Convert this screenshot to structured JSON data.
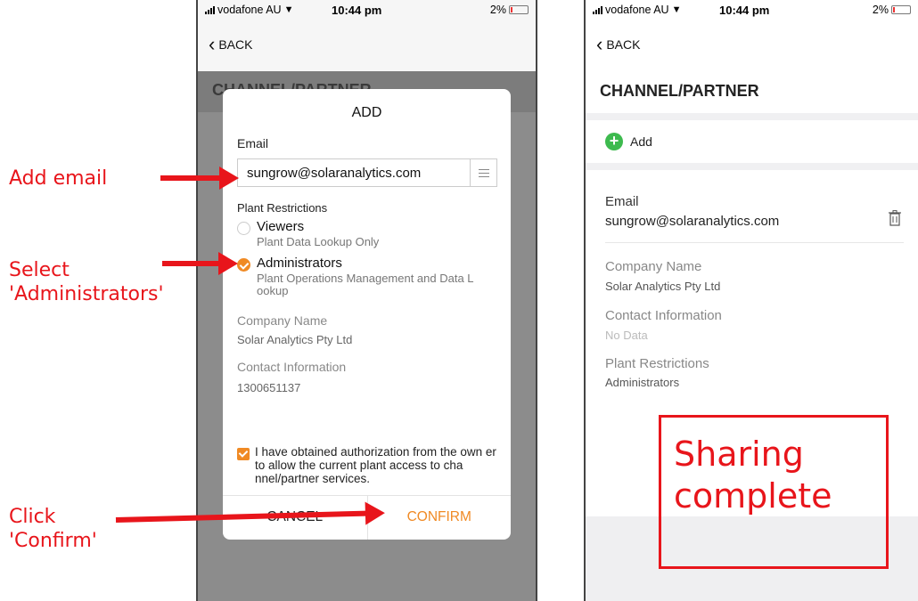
{
  "annotations": {
    "add_email": "Add email",
    "select_admins": "Select\n'Administrators'",
    "click_confirm": "Click\n'Confirm'",
    "sharing_complete": "Sharing complete"
  },
  "status_bar": {
    "carrier": "vodafone AU",
    "time": "10:44 pm",
    "battery": "2%"
  },
  "nav": {
    "back_label": "BACK"
  },
  "page_title": "CHANNEL/PARTNER",
  "dialog": {
    "title": "ADD",
    "email_label": "Email",
    "email_value": "sungrow@solaranalytics.com",
    "plant_restrictions_label": "Plant Restrictions",
    "options": [
      {
        "name": "Viewers",
        "desc": "Plant Data Lookup Only",
        "selected": false
      },
      {
        "name": "Administrators",
        "desc": "Plant Operations Management and Data L ookup",
        "selected": true
      }
    ],
    "company_label": "Company Name",
    "company_value": "Solar Analytics Pty Ltd",
    "contact_label": "Contact Information",
    "contact_value": "1300651137",
    "consent_text": "I have obtained authorization from the own er to allow the current plant access to cha nnel/partner services.",
    "cancel_label": "CANCEL",
    "confirm_label": "CONFIRM"
  },
  "partner_detail": {
    "add_label": "Add",
    "email_label": "Email",
    "email_value": "sungrow@solaranalytics.com",
    "company_label": "Company Name",
    "company_value": "Solar Analytics Pty Ltd",
    "contact_label": "Contact Information",
    "contact_value": "No Data",
    "restrictions_label": "Plant Restrictions",
    "restrictions_value": "Administrators"
  },
  "colors": {
    "accent": "#f08a24",
    "annotation": "#e8151b",
    "add_green": "#3dba4e"
  }
}
